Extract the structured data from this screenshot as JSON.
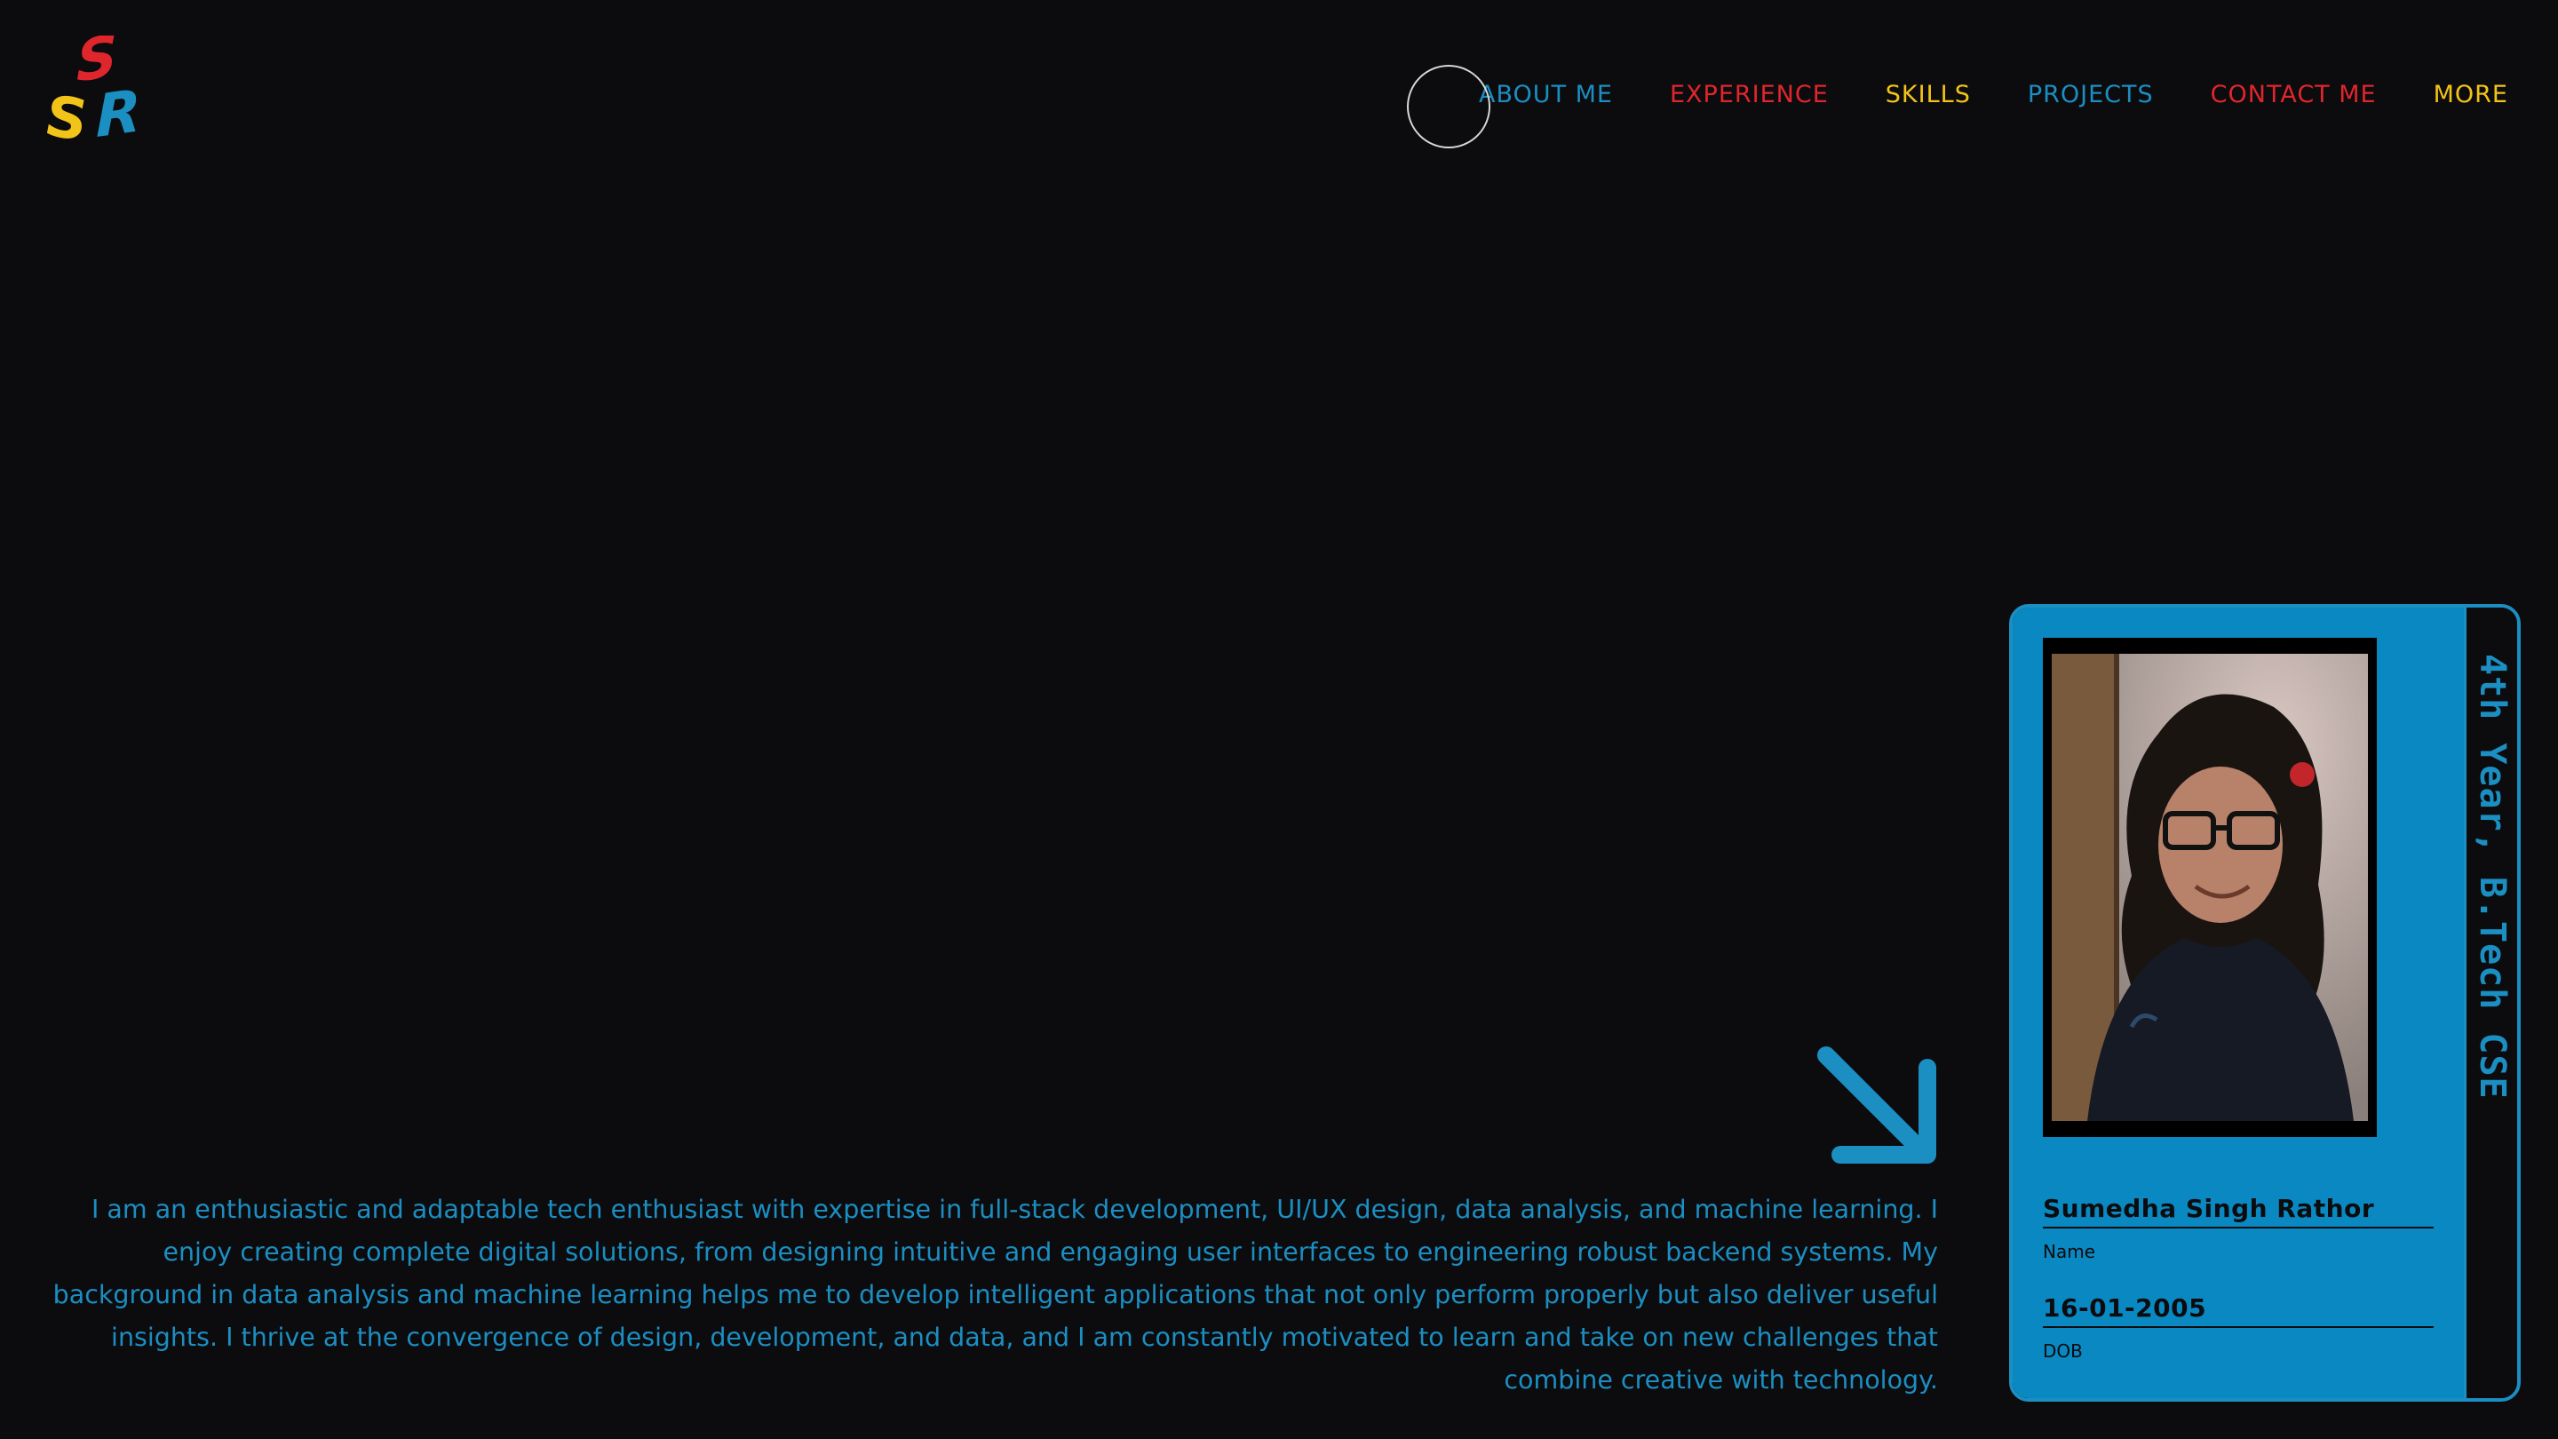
{
  "logo": {
    "letters": [
      "S",
      "S",
      "R"
    ],
    "colors": {
      "s_top": "#e0262d",
      "s_left": "#f2c318",
      "r": "#1b8ec2"
    }
  },
  "nav": {
    "items": [
      {
        "label": "ABOUT ME",
        "color": "#1b8ec2"
      },
      {
        "label": "EXPERIENCE",
        "color": "#e0262d"
      },
      {
        "label": "SKILLS",
        "color": "#f2c318"
      },
      {
        "label": "PROJECTS",
        "color": "#1b8ec2"
      },
      {
        "label": "CONTACT ME",
        "color": "#e0262d"
      },
      {
        "label": "MORE",
        "color": "#f2c318"
      }
    ]
  },
  "hero": {
    "arrow_icon": "arrow-down-right-icon",
    "intro": "I am an enthusiastic and adaptable tech enthusiast with expertise in full-stack development, UI/UX design, data analysis, and machine learning. I enjoy creating complete digital solutions, from designing intuitive and engaging user interfaces to engineering robust backend systems. My background in data analysis and machine learning helps me to develop intelligent applications that not only perform properly but also deliver useful insights. I thrive at the convergence of design, development, and data, and I am constantly motivated to learn and take on new challenges that combine creative with technology."
  },
  "id_card": {
    "side_text": "4th Year, B.Tech CSE",
    "name_value": "Sumedha Singh Rathor",
    "name_label": "Name",
    "dob_value": "16-01-2005",
    "dob_label": "DOB",
    "accent": "#0a88c2"
  },
  "colors": {
    "background": "#0c0b0d",
    "blue": "#1b8ec2",
    "red": "#e0262d",
    "yellow": "#f2c318"
  }
}
